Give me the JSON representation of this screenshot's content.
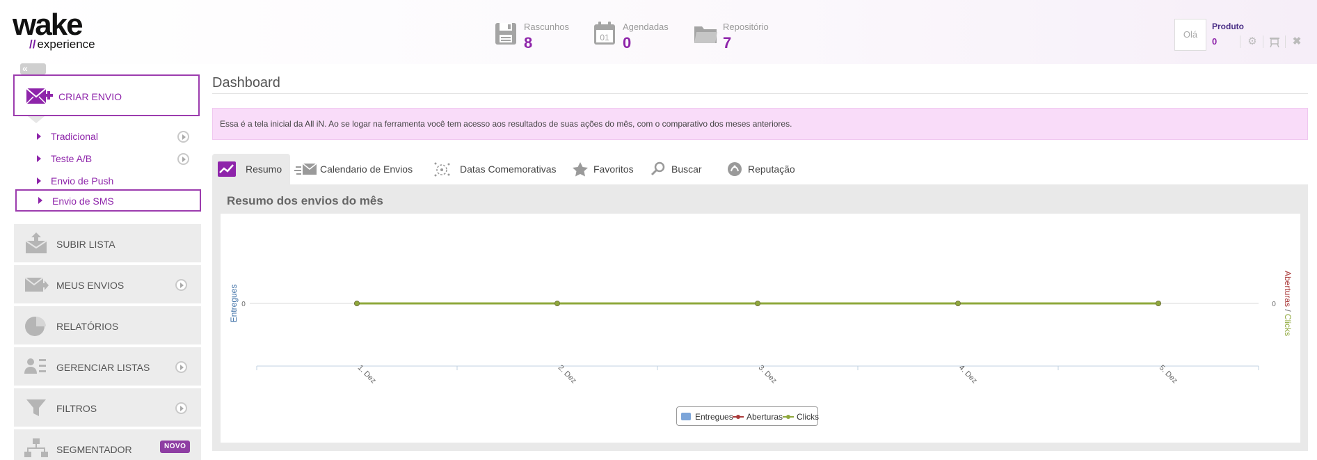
{
  "brand": {
    "logo_main": "wake",
    "logo_sub": "experience",
    "logo_slashes": "//"
  },
  "header": {
    "stats": [
      {
        "label": "Rascunhos",
        "value": "8",
        "icon": "floppy-disk-icon"
      },
      {
        "label": "Agendadas",
        "value": "0",
        "icon": "calendar-icon"
      },
      {
        "label": "Repositório",
        "value": "7",
        "icon": "folder-icon"
      }
    ],
    "greeting": "Olá",
    "product": "Produto",
    "rss_count": "0"
  },
  "sidebar": {
    "collapse_label": "«",
    "create_label": "CRIAR ENVIO",
    "subitems": [
      {
        "label": "Tradicional"
      },
      {
        "label": "Teste A/B"
      },
      {
        "label": "Envio de Push"
      },
      {
        "label": "Envio de SMS"
      }
    ],
    "menu": [
      {
        "label": "SUBIR LISTA"
      },
      {
        "label": "MEUS ENVIOS"
      },
      {
        "label": "RELATÓRIOS"
      },
      {
        "label": "GERENCIAR LISTAS"
      },
      {
        "label": "FILTROS"
      },
      {
        "label": "SEGMENTADOR",
        "badge": "NOVO"
      }
    ]
  },
  "main": {
    "title": "Dashboard",
    "alert": "Essa é a tela inicial da All iN. Ao se logar na ferramenta você tem acesso aos resultados de suas ações do mês, com o comparativo dos meses anteriores.",
    "tabs": [
      {
        "label": "Resumo"
      },
      {
        "label": "Calendario de Envios"
      },
      {
        "label": "Datas Comemorativas"
      },
      {
        "label": "Favoritos"
      },
      {
        "label": "Buscar"
      },
      {
        "label": "Reputação"
      }
    ],
    "panel_title": "Resumo dos envios do mês"
  },
  "colors": {
    "accent": "#8e24aa",
    "entregues": "#7ca5d9",
    "aberturas": "#aa3a3a",
    "clicks": "#8fa83c"
  },
  "chart_data": {
    "type": "line",
    "x": [
      "1. Dez",
      "2. Dez",
      "3. Dez",
      "4. Dez",
      "5. Dez"
    ],
    "series": [
      {
        "name": "Entregues",
        "values": [
          0,
          0,
          0,
          0,
          0
        ]
      },
      {
        "name": "Aberturas",
        "values": [
          0,
          0,
          0,
          0,
          0
        ]
      },
      {
        "name": "Clicks",
        "values": [
          0,
          0,
          0,
          0,
          0
        ]
      }
    ],
    "ylabel_left": "Entregues",
    "ylabel_right_1": "Aberturas",
    "ylabel_right_sep": "/",
    "ylabel_right_2": "Clicks",
    "y_tick_left": "0",
    "y_tick_right": "0",
    "legend_position": "bottom-center"
  }
}
